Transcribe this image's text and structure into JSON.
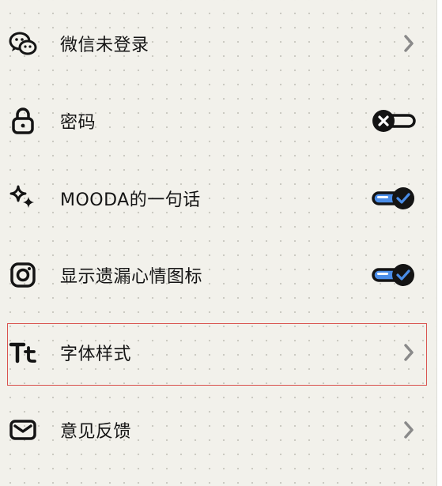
{
  "settings": {
    "items": [
      {
        "label": "微信未登录",
        "icon": "wechat-icon",
        "control": "chevron"
      },
      {
        "label": "密码",
        "icon": "lock-icon",
        "control": "toggle",
        "toggle_on": false
      },
      {
        "label": "MOODA的一句话",
        "icon": "sparkles-icon",
        "control": "toggle",
        "toggle_on": true
      },
      {
        "label": "显示遗漏心情图标",
        "icon": "instagram-icon",
        "control": "toggle",
        "toggle_on": true
      },
      {
        "label": "字体样式",
        "icon": "text-style-icon",
        "control": "chevron",
        "selected": true
      },
      {
        "label": "意见反馈",
        "icon": "mail-icon",
        "control": "chevron"
      }
    ]
  },
  "colors": {
    "background": "#f2f1eb",
    "icon": "#141414",
    "toggle_on_track": "#4a8de8",
    "chevron": "#8a8a8a",
    "selection_outline": "#d9534f"
  }
}
